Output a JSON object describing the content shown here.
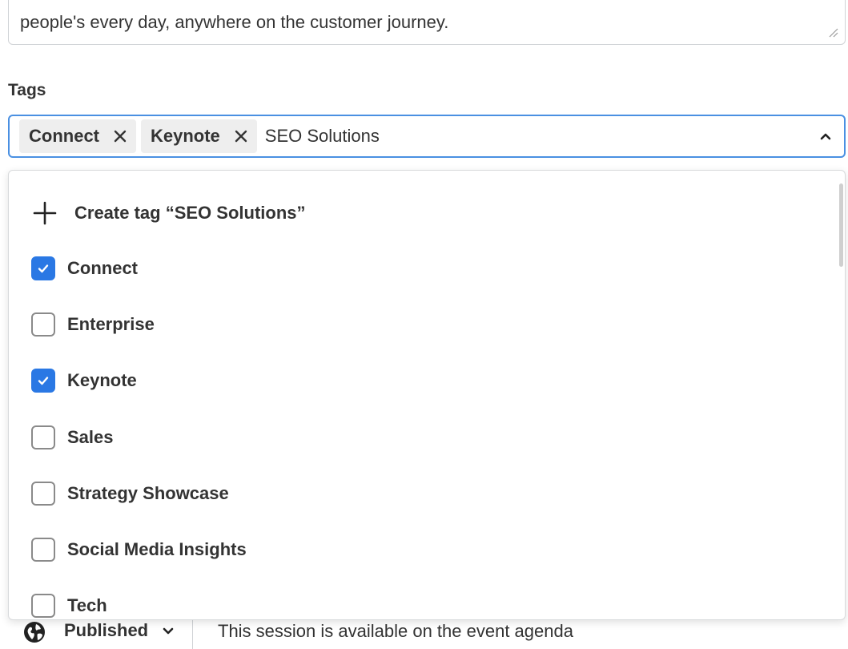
{
  "description": {
    "visible_text": "people's every day, anywhere on the customer journey."
  },
  "tags": {
    "label": "Tags",
    "selected_chips": [
      {
        "label": "Connect",
        "remove_icon": "close-icon"
      },
      {
        "label": "Keynote",
        "remove_icon": "close-icon"
      }
    ],
    "input_value": "SEO Solutions",
    "toggle_icon": "chevron-up-icon"
  },
  "dropdown": {
    "create_label": "Create tag “SEO Solutions”",
    "create_icon": "plus-icon",
    "options": [
      {
        "label": "Connect",
        "checked": true
      },
      {
        "label": "Enterprise",
        "checked": false
      },
      {
        "label": "Keynote",
        "checked": true
      },
      {
        "label": "Sales",
        "checked": false
      },
      {
        "label": "Strategy Showcase",
        "checked": false
      },
      {
        "label": "Social Media Insights",
        "checked": false
      },
      {
        "label": "Tech",
        "checked": false
      }
    ]
  },
  "status": {
    "icon": "globe-icon",
    "value": "Published",
    "description": "This session is available on the event agenda"
  },
  "colors": {
    "accent": "#2a78e4",
    "focus_border": "#4a90e2",
    "chip_bg": "#eeeeee",
    "text": "#333333"
  }
}
